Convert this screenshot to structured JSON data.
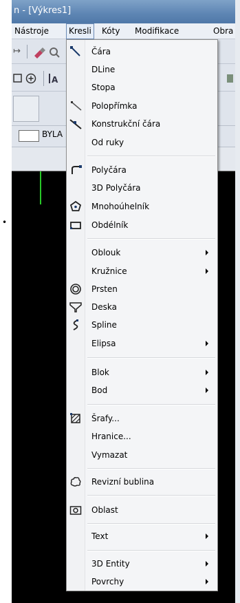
{
  "window": {
    "title": "n - [Výkres1]"
  },
  "menubar": {
    "items": [
      "Nástroje",
      "Kresli",
      "Kóty",
      "Modifikace",
      "Obra"
    ],
    "active": "Kresli"
  },
  "toolbar": {
    "layer_value": "BYLA"
  },
  "menu": {
    "items": [
      {
        "label": "Čára",
        "icon": "line-icon"
      },
      {
        "label": "DLine",
        "icon": ""
      },
      {
        "label": "Stopa",
        "icon": ""
      },
      {
        "label": "Polopřímka",
        "icon": "ray-icon"
      },
      {
        "label": "Konstrukční čára",
        "icon": "construction-line-icon"
      },
      {
        "label": "Od ruky",
        "icon": ""
      },
      {
        "label": "Polyčára",
        "icon": "polyline-icon"
      },
      {
        "label": "3D Polyčára",
        "icon": ""
      },
      {
        "label": "Mnohoúhelník",
        "icon": "polygon-icon"
      },
      {
        "label": "Obdélník",
        "icon": "rectangle-icon"
      },
      {
        "label": "Oblouk",
        "icon": "",
        "submenu": true
      },
      {
        "label": "Kružnice",
        "icon": "",
        "submenu": true
      },
      {
        "label": "Prsten",
        "icon": "donut-icon"
      },
      {
        "label": "Deska",
        "icon": "plane-icon"
      },
      {
        "label": "Spline",
        "icon": "spline-icon"
      },
      {
        "label": "Elipsa",
        "icon": "",
        "submenu": true
      },
      {
        "label": "Blok",
        "icon": "",
        "submenu": true
      },
      {
        "label": "Bod",
        "icon": "",
        "submenu": true
      },
      {
        "label": "Šrafy...",
        "icon": "hatch-icon"
      },
      {
        "label": "Hranice...",
        "icon": ""
      },
      {
        "label": "Vymazat",
        "icon": ""
      },
      {
        "label": "Revizní bublina",
        "icon": "revision-cloud-icon"
      },
      {
        "label": "Oblast",
        "icon": "region-icon"
      },
      {
        "label": "Text",
        "icon": "",
        "submenu": true
      },
      {
        "label": "3D Entity",
        "icon": "",
        "submenu": true
      },
      {
        "label": "Povrchy",
        "icon": "",
        "submenu": true
      }
    ]
  }
}
